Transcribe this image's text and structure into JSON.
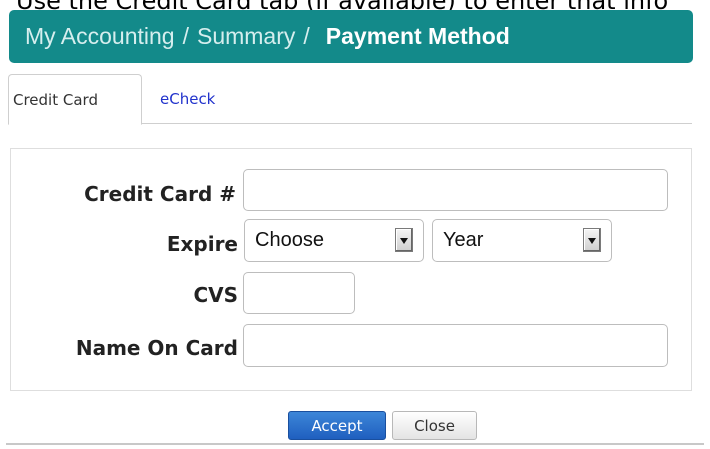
{
  "cut_text": "Use the Credit Card tab (if available) to enter that info",
  "header": {
    "crumbs": [
      "My Accounting",
      "Summary"
    ],
    "separator": "/",
    "current": "Payment Method"
  },
  "tabs": [
    {
      "label": "Credit Card",
      "active": true
    },
    {
      "label": "eCheck",
      "active": false
    }
  ],
  "form": {
    "card_number_label": "Credit Card #",
    "card_number_value": "",
    "expire_label": "Expire",
    "expire_month": "Choose",
    "expire_year": "Year",
    "cvs_label": "CVS",
    "cvs_value": "",
    "name_label": "Name On Card",
    "name_value": ""
  },
  "buttons": {
    "accept_label": "Accept",
    "close_label": "Close"
  },
  "colors": {
    "header_bg": "#138a8a",
    "link": "#2233cc",
    "accept_bg": "#2a6fce"
  },
  "icons": {
    "select_arrow": "chevron-down-icon"
  }
}
